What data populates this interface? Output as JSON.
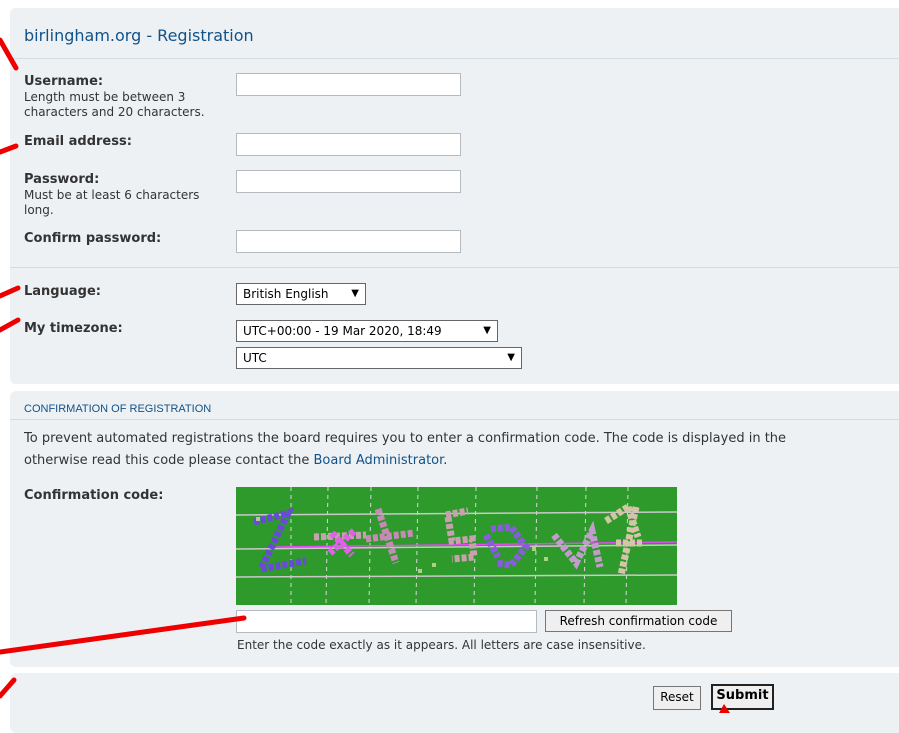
{
  "registration": {
    "title": "birlingham.org - Registration",
    "username_label": "Username:",
    "username_hint": "Length must be between 3 characters and 20 characters.",
    "username_value": "",
    "email_label": "Email address:",
    "email_value": "",
    "password_label": "Password:",
    "password_hint": "Must be at least 6 characters long.",
    "password_value": "",
    "confirm_password_label": "Confirm password:",
    "confirm_password_value": "",
    "language_label": "Language:",
    "language_value": "British English",
    "timezone_label": "My timezone:",
    "timezone_value": "UTC+00:00 - 19 Mar 2020, 18:49",
    "timezone_zone_value": "UTC"
  },
  "confirmation": {
    "header": "CONFIRMATION OF REGISTRATION",
    "text_line1": "To prevent automated registrations the board requires you to enter a confirmation code. The code is displayed in the",
    "text_line2_before": "otherwise read this code please contact the ",
    "admin_link": "Board Administrator",
    "text_line2_after": ".",
    "code_label": "Confirmation code:",
    "code_value": "",
    "refresh_label": "Refresh confirmation code",
    "hint": "Enter the code exactly as it appears. All letters are case insensitive."
  },
  "actions": {
    "reset_label": "Reset",
    "submit_label": "Submit"
  },
  "colors": {
    "accent": "#105289",
    "panel": "#eef1f4",
    "captcha_bg": "#2e9a2b",
    "annotation": "#ee0000"
  },
  "icons": {
    "dropdown": "triangle-down-icon"
  }
}
